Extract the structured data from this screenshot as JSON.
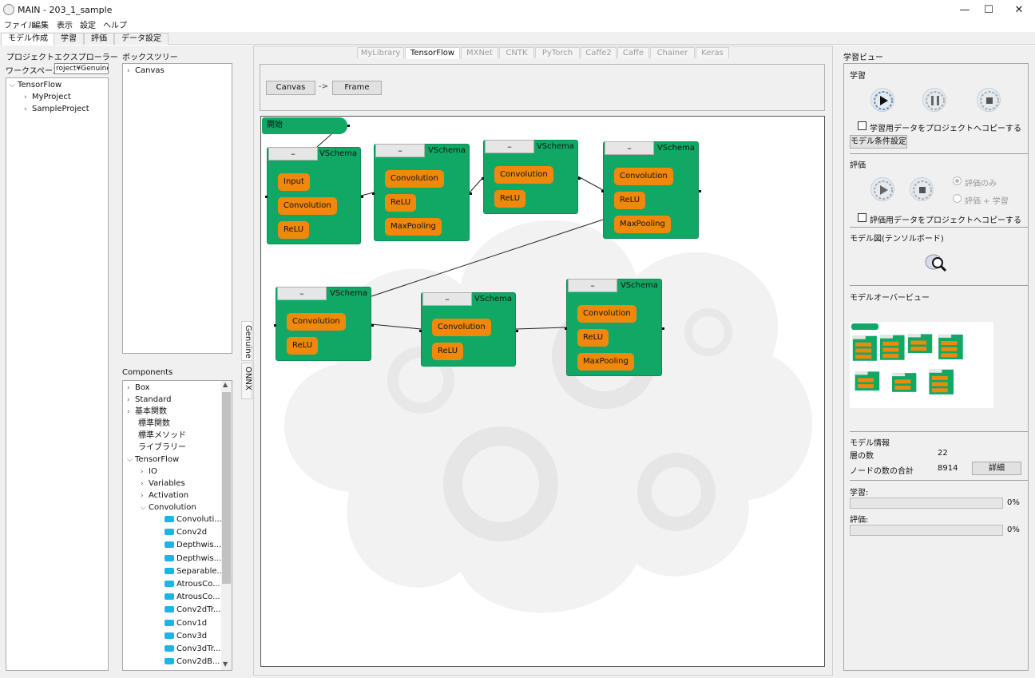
{
  "window": {
    "title": "MAIN - 203_1_sample",
    "minimize": "—",
    "maximize": "☐",
    "close": "✕"
  },
  "menu": [
    "ファイル",
    "編集",
    "表示",
    "設定",
    "ヘルプ"
  ],
  "main_tabs": [
    "モデル作成",
    "学習",
    "評価",
    "データ設定"
  ],
  "explorer": {
    "title": "プロジェクトエクスプローラー",
    "workspace_label": "ワークスペース",
    "workspace_value": "roject¥Genuine",
    "tree": [
      {
        "label": "TensorFlow",
        "expanded": true
      },
      {
        "label": "MyProject"
      },
      {
        "label": "SampleProject"
      }
    ]
  },
  "boxtree": {
    "title": "ボックスツリー",
    "items": [
      "Canvas"
    ]
  },
  "components": {
    "title": "Components",
    "items": [
      "Box",
      "Standard",
      "基本関数",
      "標準関数",
      "標準メソッド",
      "ライブラリー",
      "TensorFlow",
      "IO",
      "Variables",
      "Activation",
      "Convolution"
    ],
    "conv_items": [
      "Convoluti...",
      "Conv2d",
      "Depthwis...",
      "Depthwis...",
      "Separable...",
      "AtrousCo...",
      "AtrousCo...",
      "Conv2dTr...",
      "Conv1d",
      "Conv3d",
      "Conv3dTr...",
      "Conv2dB..."
    ]
  },
  "framework_tabs": [
    "MyLibrary",
    "TensorFlow",
    "MXNet",
    "CNTK",
    "PyTorch",
    "Caffe2",
    "Caffe",
    "Chainer",
    "Keras"
  ],
  "side_tabs": [
    "Genuine",
    "ONNX"
  ],
  "breadcrumb": {
    "canvas": "Canvas",
    "arrow": "->",
    "frame": "Frame"
  },
  "canvas": {
    "start_label": "開始",
    "schema_label": "VSchema",
    "node_header": "–",
    "nodes": [
      {
        "ops": [
          "Input",
          "Convolution",
          "ReLU"
        ]
      },
      {
        "ops": [
          "Convolution",
          "ReLU",
          "MaxPooling"
        ]
      },
      {
        "ops": [
          "Convolution",
          "ReLU"
        ]
      },
      {
        "ops": [
          "Convolution",
          "ReLU",
          "MaxPooling"
        ]
      },
      {
        "ops": [
          "Convolution",
          "ReLU"
        ]
      },
      {
        "ops": [
          "Convolution",
          "ReLU"
        ]
      },
      {
        "ops": [
          "Convolution",
          "ReLU",
          "MaxPooling"
        ]
      }
    ]
  },
  "right": {
    "title": "学習ビュー",
    "train_section": "学習",
    "copy_train": "学習用データをプロジェクトへコピーする",
    "model_cond_button": "モデル条件設定",
    "eval_section": "評価",
    "radio_eval_only": "評価のみ",
    "radio_eval_train": "評価 + 学習",
    "copy_eval": "評価用データをプロジェクトへコピーする",
    "tensorboard": "モデル図(テンソルボード)",
    "overview": "モデルオーバービュー",
    "model_info": "モデル情報",
    "layers_label": "層の数",
    "layers_value": "22",
    "nodes_label": "ノードの数の合計",
    "nodes_value": "8914",
    "detail_button": "詳細",
    "train_progress_label": "学習:",
    "train_progress_value": "0%",
    "train_progress": 0,
    "eval_progress_label": "評価:",
    "eval_progress_value": "0%",
    "eval_progress": 0
  },
  "colors": {
    "node": "#11a866",
    "op": "#f0880c",
    "component_icon": "#1fb3e8"
  }
}
